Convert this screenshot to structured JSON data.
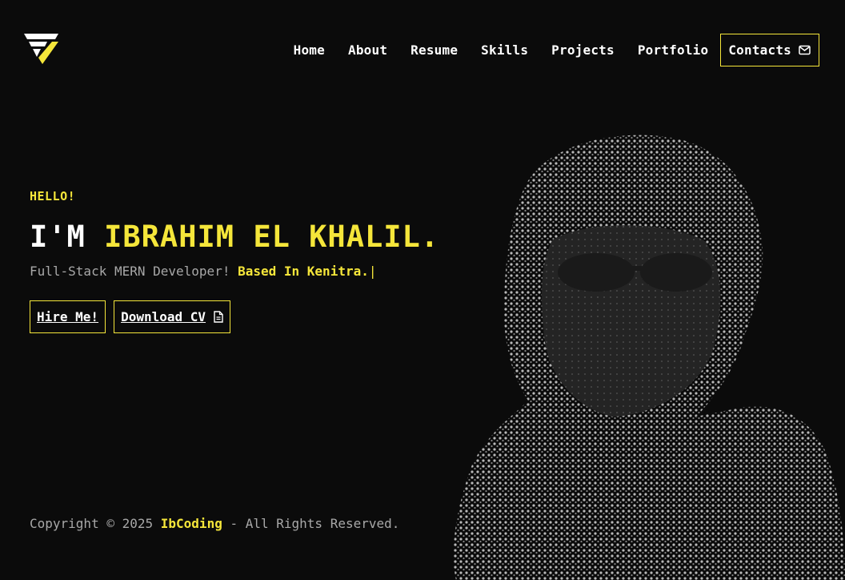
{
  "header": {
    "logo_name": "fi-logo",
    "nav": {
      "home": "Home",
      "about": "About",
      "resume": "Resume",
      "skills": "Skills",
      "projects": "Projects",
      "portfolio": "Portfolio",
      "contacts": "Contacts"
    }
  },
  "hero": {
    "hello": "HELLO!",
    "name_prefix": "I'M ",
    "name": "IBRAHIM EL KHALIL.",
    "subtitle": "Full-Stack MERN Developer!",
    "location": "Based In Kenitra.",
    "caret": "|",
    "hire_button": "Hire Me!",
    "download_button": "Download CV"
  },
  "footer": {
    "prefix": "Copyright © 2025",
    "brand": "IbCoding",
    "suffix": "- All Rights Reserved."
  },
  "colors": {
    "accent": "#f5e63a",
    "background": "#0b0b0b",
    "text": "#ffffff",
    "muted": "#a8a8a8"
  },
  "icons": {
    "contacts": "mail-icon",
    "download": "document-icon"
  }
}
